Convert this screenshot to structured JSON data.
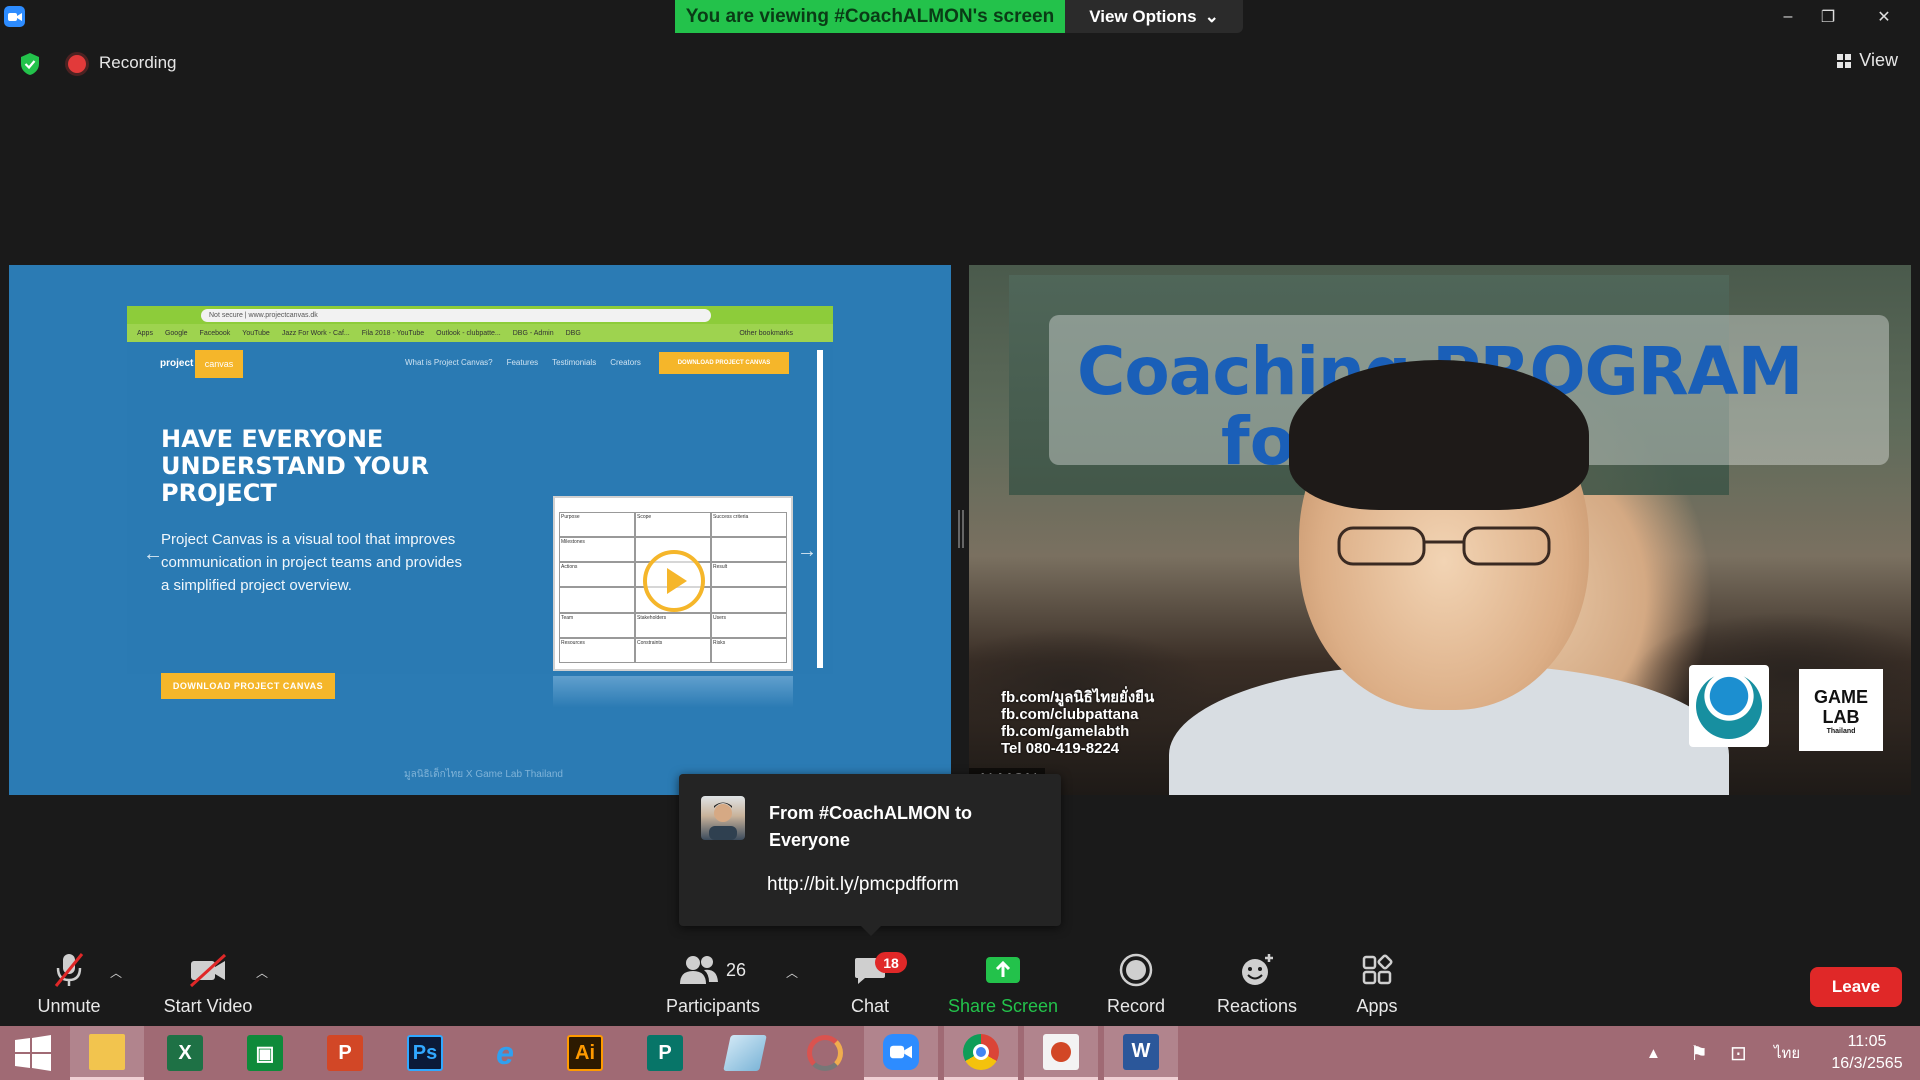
{
  "titlebar": {
    "viewing_banner": "You are viewing #CoachALMON's screen",
    "view_options_label": "View Options",
    "minimize_glyph": "–",
    "restore_glyph": "❐",
    "close_glyph": "✕"
  },
  "status": {
    "recording_label": "Recording",
    "view_label": "View"
  },
  "shared_screen": {
    "address": "Not secure | www.projectcanvas.dk",
    "bookmarks": [
      "Apps",
      "Google",
      "Facebook",
      "YouTube",
      "Jazz For Work - Caf...",
      "Fila 2018 - YouTube",
      "Outlook - clubpatte...",
      "DBG - Admin",
      "DBG",
      "Other bookmarks"
    ],
    "logo_project": "project",
    "logo_canvas": "canvas",
    "nav_links": [
      "What is Project Canvas?",
      "Features",
      "Testimonials",
      "Creators"
    ],
    "nav_download": "DOWNLOAD PROJECT CANVAS",
    "hero_title": "HAVE EVERYONE UNDERSTAND YOUR PROJECT",
    "hero_text": "Project Canvas is a visual tool that improves communication in project teams and provides a simplified project overview.",
    "hero_button": "DOWNLOAD PROJECT CANVAS",
    "canvas_cells": [
      "Purpose",
      "Scope",
      "Success criteria",
      "Milestones",
      "",
      "",
      "Actions",
      "",
      "Result",
      "",
      "",
      "",
      "Team",
      "Stakeholders",
      "Users",
      "Resources",
      "Constraints",
      "Risks"
    ],
    "footer": "มูลนิธิเด็กไทย X Game Lab Thailand"
  },
  "video": {
    "title_line1": "Coaching PROGRAM",
    "title_line2": "for     urer",
    "contacts": [
      "fb.com/มูลนิธิไทยยั่งยืน",
      "fb.com/clubpattana",
      "fb.com/gamelabth",
      "Tel 080-419-8224"
    ],
    "logo_game_lab": "GAME LAB",
    "logo_game_lab_sub": "Thailand",
    "speaker_name": "ALMON"
  },
  "chat_popup": {
    "from": "From #CoachALMON to Everyone",
    "message": "http://bit.ly/pmcpdfform"
  },
  "toolbar": {
    "unmute": "Unmute",
    "start_video": "Start Video",
    "participants_count": "26",
    "participants": "Participants",
    "chat_badge": "18",
    "chat": "Chat",
    "share_screen": "Share Screen",
    "record": "Record",
    "reactions": "Reactions",
    "apps": "Apps",
    "leave": "Leave"
  },
  "taskbar": {
    "apps": [
      "File Explorer",
      "Excel",
      "Store",
      "PowerPoint",
      "Photoshop",
      "Internet Explorer",
      "Illustrator",
      "Publisher",
      "Notepad",
      "PhotoScape",
      "Zoom",
      "Chrome",
      "Office",
      "Word"
    ],
    "language": "ไทย",
    "time": "11:05",
    "date": "16/3/2565"
  },
  "colors": {
    "accent_green": "#23c24b",
    "leave_red": "#e02828",
    "zoom_blue": "#2d8cff",
    "taskbar": "#a06a74"
  }
}
